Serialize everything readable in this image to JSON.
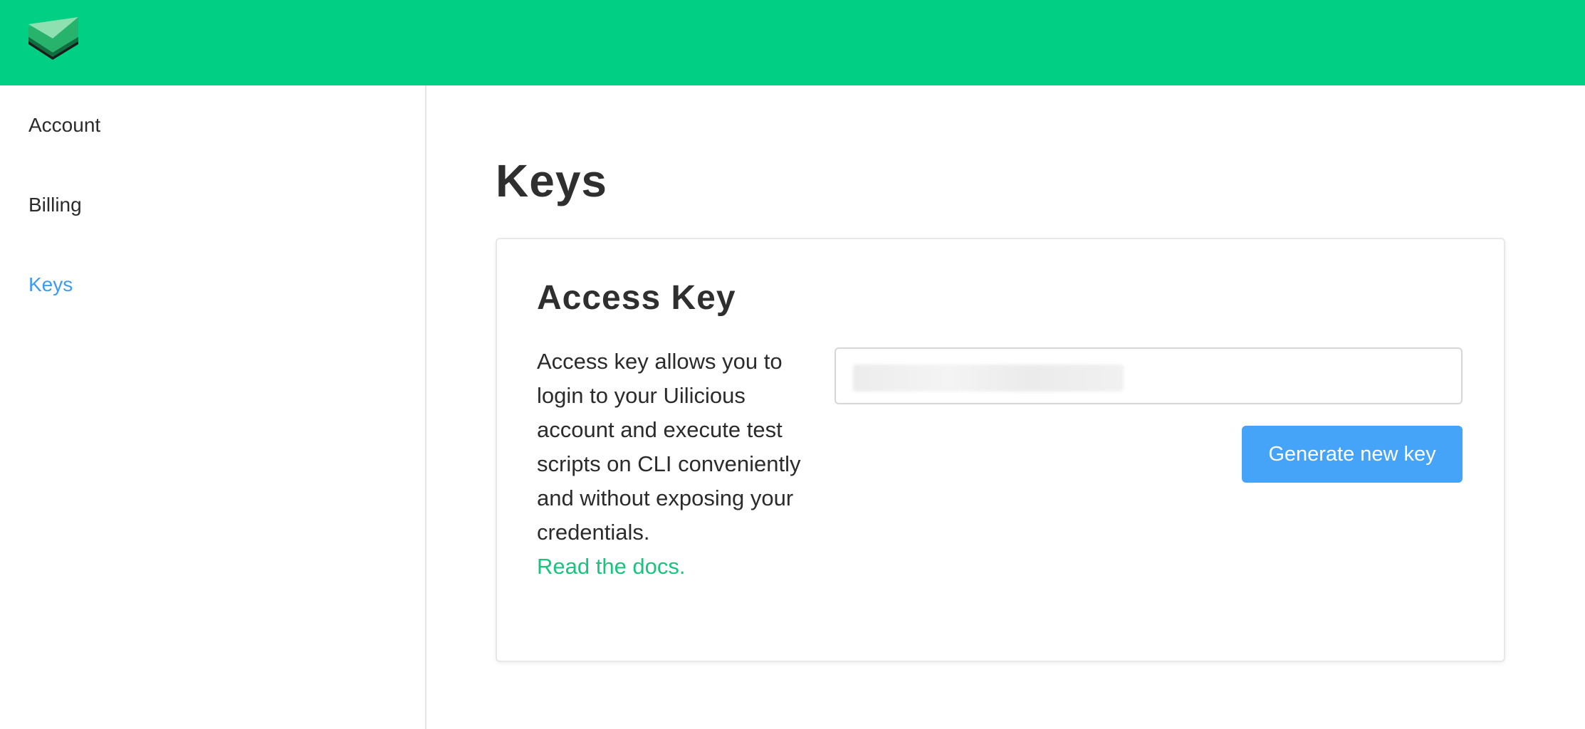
{
  "header": {
    "logo_icon": "uilicious-logo-icon",
    "brand_color": "#00cf84"
  },
  "sidebar": {
    "items": [
      {
        "label": "Account",
        "active": false
      },
      {
        "label": "Billing",
        "active": false
      },
      {
        "label": "Keys",
        "active": true
      }
    ],
    "active_color": "#3d9bf4"
  },
  "main": {
    "page_title": "Keys",
    "card": {
      "title": "Access Key",
      "description": "Access key allows you to login to your Uilicious account and execute test scripts on CLI conveniently and without exposing your credentials.",
      "docs_link": "Read the docs.",
      "docs_link_color": "#19c47e",
      "key_value": "",
      "generate_button": "Generate new key",
      "button_color": "#45a4f7"
    }
  }
}
